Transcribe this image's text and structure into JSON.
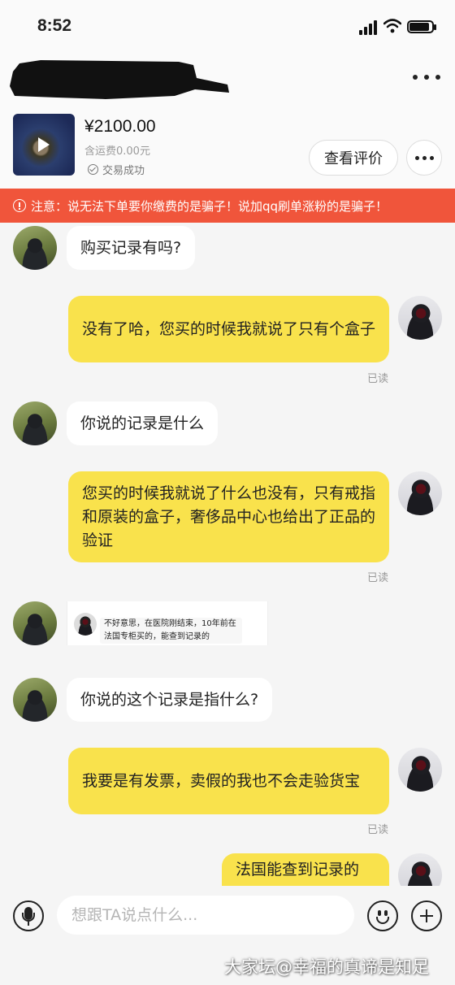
{
  "status_bar": {
    "time": "8:52"
  },
  "header": {
    "title_redacted": true
  },
  "product": {
    "price": "¥2100.00",
    "shipping": "含运费0.00元",
    "deal_status": "交易成功",
    "review_button": "查看评价"
  },
  "warning": {
    "text": "注意：说无法下单要你缴费的是骗子！说加qq刷单涨粉的是骗子！"
  },
  "messages": [
    {
      "from": "buyer",
      "text": "购买记录有吗?"
    },
    {
      "from": "seller",
      "text": "没有了哈，您买的时候我就说了只有个盒子",
      "status": "已读"
    },
    {
      "from": "buyer",
      "text": "你说的记录是什么"
    },
    {
      "from": "seller",
      "text": "您买的时候我就说了什么也没有，只有戒指和原装的盒子，奢侈品中心也给出了正品的验证",
      "status": "已读"
    },
    {
      "from": "buyer",
      "type": "image",
      "image_text": "不好意思，在医院刚结束，10年前在法国专柜买的，能查到记录的"
    },
    {
      "from": "buyer",
      "text": "你说的这个记录是指什么?"
    },
    {
      "from": "seller",
      "text": "我要是有发票，卖假的我也不会走验货宝",
      "status": "已读"
    },
    {
      "from": "seller",
      "text": "法国能查到记录的"
    }
  ],
  "input": {
    "placeholder": "想跟TA说点什么..."
  },
  "watermark": "大家坛@幸福的真谛是知足",
  "colors": {
    "warning_bg": "#f0553b",
    "seller_bubble": "#f9e24c",
    "buyer_bubble": "#ffffff"
  }
}
